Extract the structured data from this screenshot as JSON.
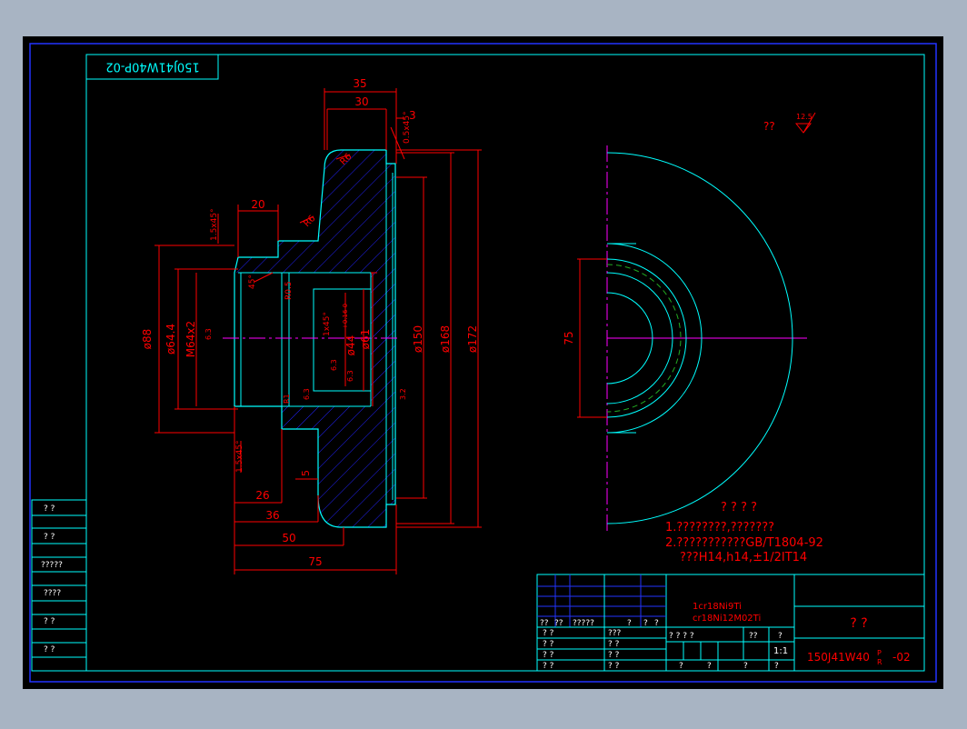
{
  "colors": {
    "outer_bg": "#a8b4c3",
    "canvas": "#000000",
    "frame": "#00ffff",
    "dim": "#ff0000",
    "part": "#00ffff",
    "hatch": "#2222ff",
    "center": "#ff00ff",
    "dashed": "#22aa22",
    "text_white": "#ffffff",
    "border_blue": "#2233ff"
  },
  "drawing_no_top": "150J41W40P-02",
  "drawing_no_top_sub": "R",
  "dims": {
    "d35": "35",
    "d30": "30",
    "d3": "3",
    "d05x45": "0.5x45°",
    "r6_top": "R6",
    "r6_mid": "R6",
    "d20": "20",
    "c15x45_top": "1.5x45°",
    "a45": "45°",
    "r05": "R0.5",
    "c1x45": "1x45°",
    "tol": "+0.16 0",
    "d88": "ø88",
    "d644": "ø64.4",
    "m64": "M64x2",
    "d44": "ø44",
    "d61": "ø61",
    "d150": "ø150",
    "d168": "ø168",
    "d172": "ø172",
    "r63_a": "6.3",
    "r63_b": "6.3",
    "r63_c": "6.3",
    "r63_d": "6.3",
    "r63_e": "3.2",
    "r1": "R1",
    "c15x45_bot": "1.5x45°",
    "d5": "5",
    "d26": "26",
    "d36": "36",
    "d50": "50",
    "d75": "75",
    "d75_v": "75"
  },
  "roughness": {
    "label": "??",
    "value": "12.5"
  },
  "notes": {
    "heading": "? ? ? ?",
    "line1": "1.????????,???????",
    "line2": "2.???????????GB/T1804-92",
    "line3": "???H14,h14,±1/2IT14"
  },
  "left_table": [
    "? ?",
    "? ?",
    "?????",
    "????",
    "? ?",
    "? ?"
  ],
  "title_block": {
    "material1": "1cr18Ni9Ti",
    "material2": "cr18Ni12M02Ti",
    "name": "?    ?",
    "drawing_no": "150J41W40",
    "drawing_no_p": "P",
    "drawing_no_r": "R",
    "drawing_no_suffix": "-02",
    "scale": "1:1",
    "hdr_row": [
      "??",
      "??",
      "?????",
      "?",
      "?",
      "?"
    ],
    "sign_rows": [
      "? ?",
      "? ?",
      "? ?",
      "? ?"
    ],
    "sign_rows_mid": [
      "???",
      "? ?",
      "? ?",
      "? ?"
    ],
    "stage_hdr": [
      "? ? ? ?",
      "??",
      "?"
    ],
    "bottom_row": [
      "?",
      "?",
      "?",
      "?"
    ]
  }
}
